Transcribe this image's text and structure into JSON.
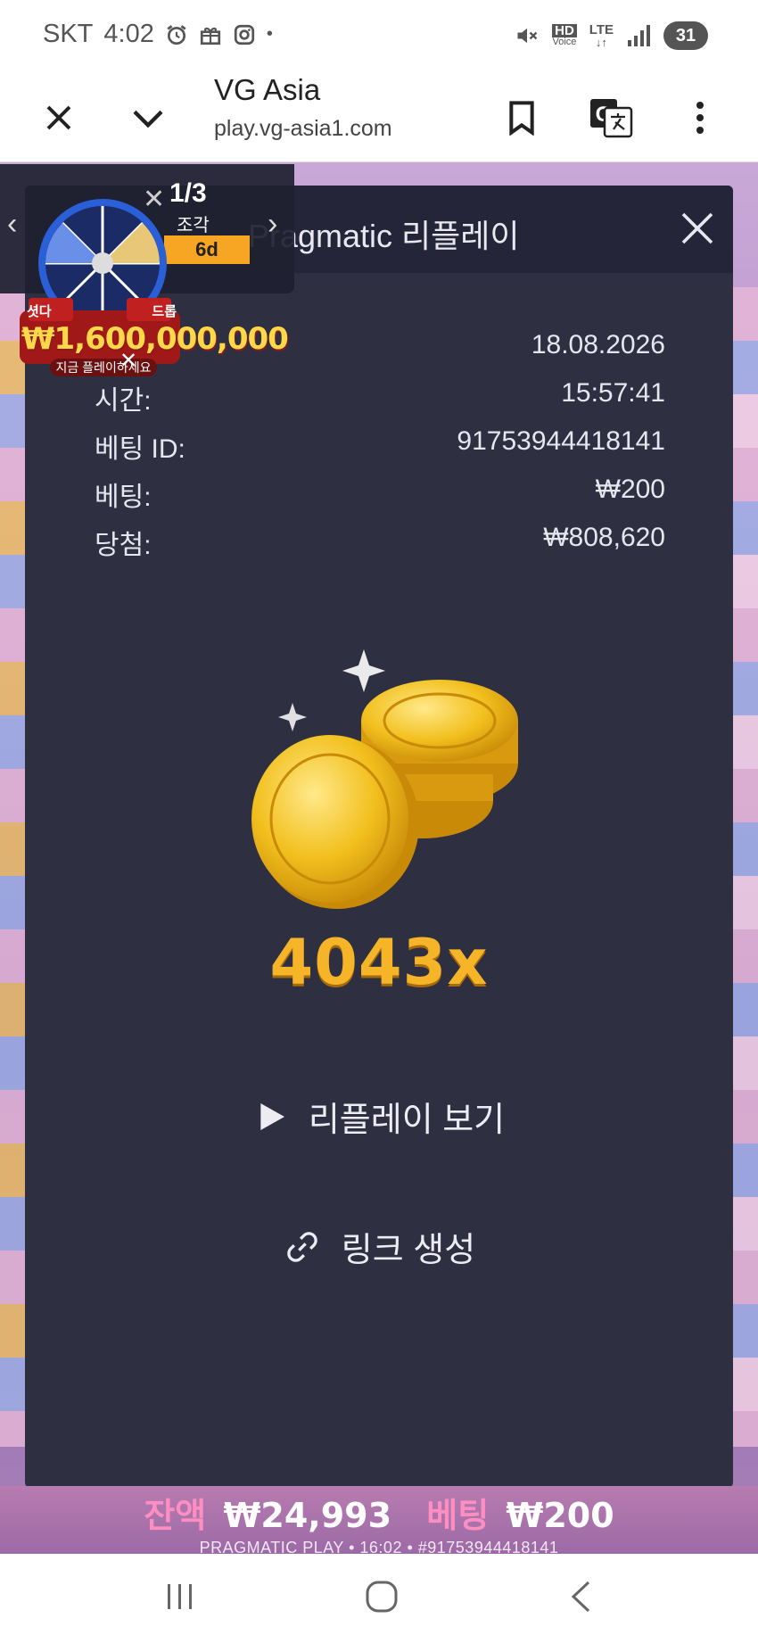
{
  "status_bar": {
    "carrier": "SKT",
    "time": "4:02",
    "dot": "•",
    "hd_top": "HD",
    "hd_bottom": "Voice",
    "lte": "LTE",
    "battery": "31"
  },
  "browser": {
    "title": "VG Asia",
    "url": "play.vg-asia1.com"
  },
  "dialog": {
    "title": "Pragmatic 리플레이",
    "rows": [
      {
        "label": "",
        "value": "18.08.2026"
      },
      {
        "label": "시간:",
        "value": "15:57:41"
      },
      {
        "label": "베팅 ID:",
        "value": "91753944418141"
      },
      {
        "label": "베팅:",
        "value": "₩200"
      },
      {
        "label": "당첨:",
        "value": "₩808,620"
      }
    ],
    "multiplier": "4043x",
    "watch_replay_label": "리플레이 보기",
    "create_link_label": "링크 생성"
  },
  "promo": {
    "count": "1/3",
    "unit": "조각",
    "badge": "6d",
    "jackpot_tag_left": "셧다",
    "jackpot_tag_right": "드롭",
    "jackpot_amount": "₩1,600,000,000",
    "jackpot_play": "지금 플레이하세요"
  },
  "game_footer": {
    "balance_label": "잔액",
    "balance_value": "₩24,993",
    "bet_label": "베팅",
    "bet_value": "₩200",
    "info_line": "PRAGMATIC PLAY • 16:02 • #91753944418141"
  },
  "colors": {
    "dialog_bg": "#2f2f42",
    "multiplier": "#f6b428",
    "coin": "#f2c01e"
  },
  "icons": [
    "close-icon",
    "chevron-down-icon",
    "bookmark-icon",
    "translate-icon",
    "more-vert-icon",
    "play-icon",
    "link-icon"
  ]
}
